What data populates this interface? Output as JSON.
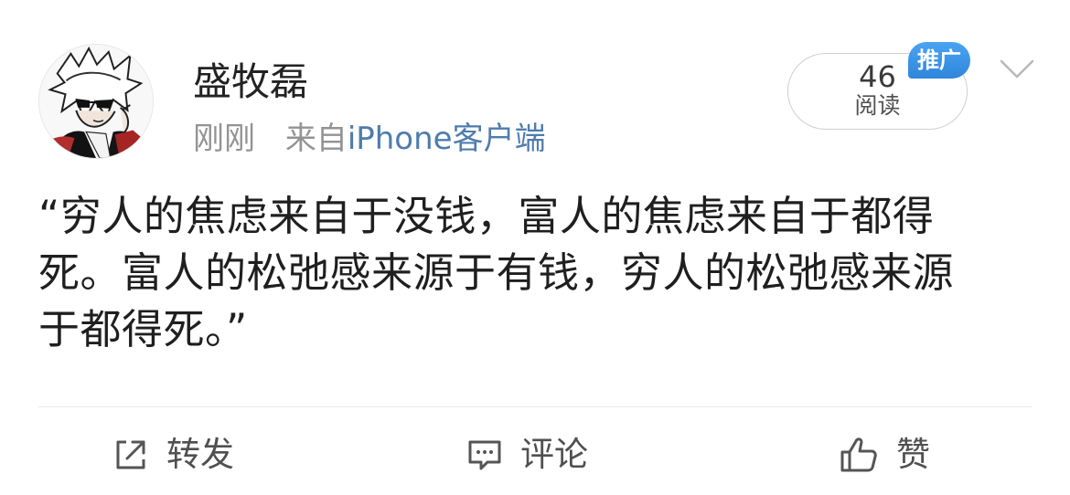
{
  "post": {
    "author": {
      "name": "盛牧磊",
      "avatar_icon": "cartoon-sunglasses-avatar"
    },
    "meta": {
      "time": "刚刚",
      "source_prefix": "来自",
      "client": "iPhone客户端"
    },
    "read": {
      "count": "46",
      "label": "阅读"
    },
    "promo_badge": "推广",
    "content_lines": [
      "“穷人的焦虑来自于没钱，富人的焦虑来自于都得",
      "死。富人的松弛感来源于有钱，穷人的松弛感来源",
      "于都得死。”"
    ]
  },
  "actions": {
    "repost": {
      "label": "转发",
      "icon": "share-icon"
    },
    "comment": {
      "label": "评论",
      "icon": "comment-icon"
    },
    "like": {
      "label": "赞",
      "icon": "thumbs-up-icon"
    }
  },
  "colors": {
    "link_blue": "#4f7cae",
    "badge_blue": "#3d97e8",
    "muted_text": "#939393",
    "body_text": "#1f1f1f"
  }
}
